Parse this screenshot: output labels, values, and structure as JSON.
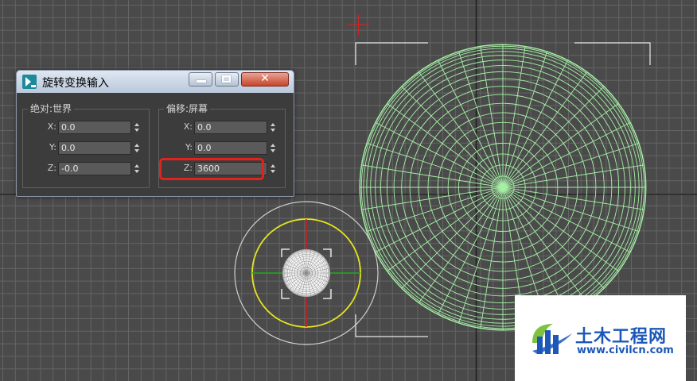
{
  "window": {
    "title": "旋转变换输入",
    "close_glyph": "✕"
  },
  "absolute": {
    "label": "绝对:世界",
    "rows": [
      {
        "axis": "X:",
        "value": "0.0"
      },
      {
        "axis": "Y:",
        "value": "0.0"
      },
      {
        "axis": "Z:",
        "value": "-0.0"
      }
    ]
  },
  "offset": {
    "label": "偏移:屏幕",
    "rows": [
      {
        "axis": "X:",
        "value": "0.0"
      },
      {
        "axis": "Y:",
        "value": "0.0"
      },
      {
        "axis": "Z:",
        "value": "3600"
      }
    ]
  },
  "watermark": {
    "name": "土木工程网",
    "url": "www.civilcn.com"
  },
  "colors": {
    "viewport_bg": "#4a4a4a",
    "grid": "#646464",
    "wireframe": "#a6f0a6",
    "gizmo_yellow": "#e6e61e",
    "axis_red": "#d21e1e",
    "axis_green": "#1eaa1e",
    "highlight": "#e0231c",
    "brand_blue": "#1c58b8"
  },
  "icons": {
    "app": "3dsmax-logo-icon",
    "minimize": "minimize-icon",
    "maximize": "maximize-icon",
    "close": "close-icon",
    "spinner": "spinner-arrows-icon",
    "brand": "civilcn-logo-icon"
  }
}
